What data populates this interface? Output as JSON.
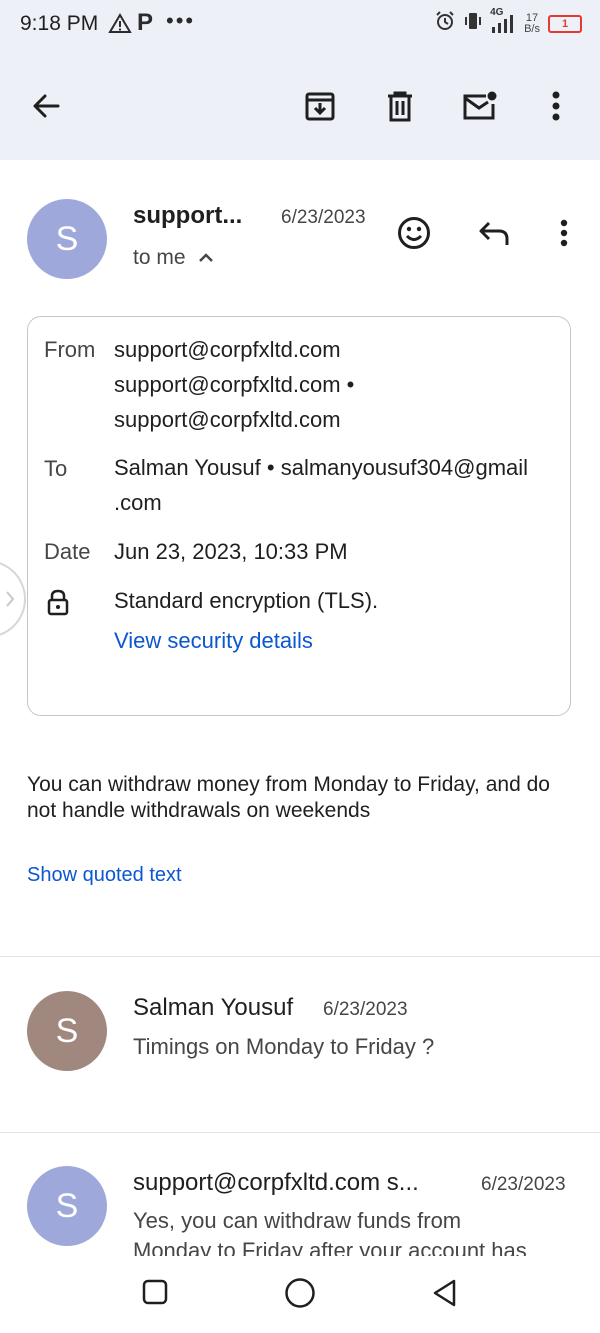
{
  "status_bar": {
    "time": "9:18 PM",
    "network_label": "4G",
    "speed_value": "17",
    "speed_unit": "B/s",
    "battery": "1"
  },
  "toolbar": {
    "back_icon": "arrow-left-icon",
    "archive_icon": "archive-icon",
    "delete_icon": "trash-icon",
    "mark_unread_icon": "mail-unread-icon",
    "more_icon": "more-vert-icon"
  },
  "message": {
    "avatar_letter": "S",
    "sender": "support...",
    "date": "6/23/2023",
    "recipient_line": "to me",
    "details": {
      "from_label": "From",
      "from_line1": "support@corpfxltd.com",
      "from_line2": "support@corpfxltd.com •",
      "from_line3": "support@corpfxltd.com",
      "to_label": "To",
      "to_line1": "Salman Yousuf • salmanyousuf304@gmail",
      "to_line2": ".com",
      "date_label": "Date",
      "date_value": "Jun 23, 2023, 10:33 PM",
      "encryption": "Standard encryption (TLS).",
      "security_link": "View security details"
    },
    "body": "You can withdraw money from Monday to Friday, and do not handle withdrawals on weekends",
    "show_quoted": "Show quoted text"
  },
  "thread": [
    {
      "avatar_letter": "S",
      "avatar_color": "#a1887f",
      "sender": "Salman Yousuf",
      "date": "6/23/2023",
      "snippet": "Timings on Monday to Friday ?"
    },
    {
      "avatar_letter": "S",
      "avatar_color": "#9fa8da",
      "sender": "support@corpfxltd.com s...",
      "date": "6/23/2023",
      "snippet_line1": "Yes, you can withdraw funds from",
      "snippet_line2": "Monday to Friday after your account has"
    }
  ],
  "colors": {
    "toolbar_bg": "#edf1f7",
    "avatar_blue": "#9fa8da",
    "link_blue": "#0b57d0"
  }
}
